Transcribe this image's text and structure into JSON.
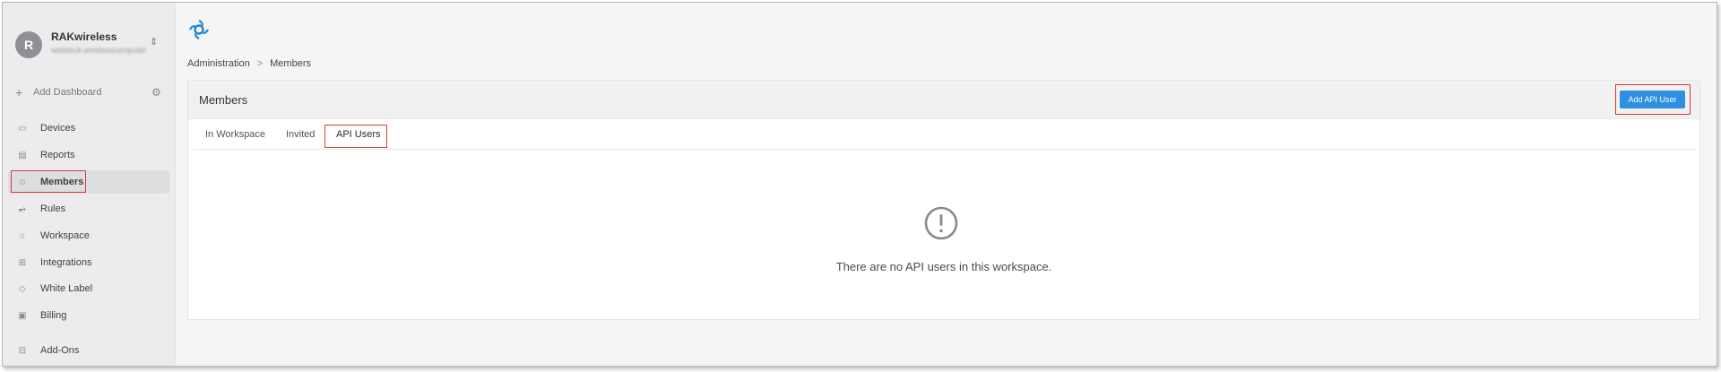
{
  "workspace": {
    "avatar_letter": "R",
    "name": "RAKwireless",
    "subtitle": "wisblock.wirelesscomputer"
  },
  "sidebar": {
    "add_dashboard": "Add Dashboard",
    "items": [
      {
        "label": "Devices",
        "icon": "devices-icon"
      },
      {
        "label": "Reports",
        "icon": "reports-icon"
      },
      {
        "label": "Members",
        "icon": "members-icon",
        "active": true
      },
      {
        "label": "Rules",
        "icon": "rules-icon"
      },
      {
        "label": "Workspace",
        "icon": "workspace-icon"
      },
      {
        "label": "Integrations",
        "icon": "integrations-icon"
      },
      {
        "label": "White Label",
        "icon": "tag-icon"
      },
      {
        "label": "Billing",
        "icon": "billing-icon"
      },
      {
        "label": "Add-Ons",
        "icon": "addons-icon"
      }
    ]
  },
  "breadcrumb": {
    "parent": "Administration",
    "separator": ">",
    "current": "Members"
  },
  "panel": {
    "title": "Members",
    "add_button": "Add API User",
    "tabs": [
      {
        "label": "In Workspace"
      },
      {
        "label": "Invited"
      },
      {
        "label": "API Users",
        "active": true
      }
    ],
    "empty_message": "There are no API users in this workspace."
  },
  "colors": {
    "accent": "#2f8fe0",
    "highlight": "#d63a3a",
    "sidebar_bg": "#ececee"
  }
}
